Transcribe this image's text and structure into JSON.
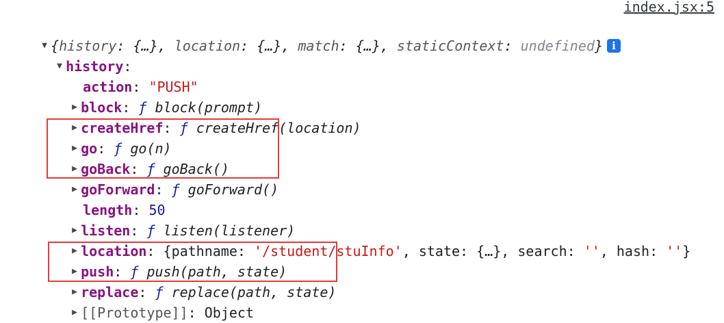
{
  "source_link": "index.jsx:5",
  "root": {
    "preview_open": "{",
    "preview_items": [
      {
        "key": "history",
        "value": "{…}"
      },
      {
        "key": "location",
        "value": "{…}"
      },
      {
        "key": "match",
        "value": "{…}"
      },
      {
        "key": "staticContext",
        "value": "undefined"
      }
    ],
    "preview_close": "}",
    "info_icon": "i"
  },
  "history": {
    "label": "history",
    "action": {
      "key": "action",
      "value": "\"PUSH\""
    },
    "block": {
      "key": "block",
      "f": "ƒ",
      "sig": "block(prompt)"
    },
    "createHref": {
      "key": "createHref",
      "f": "ƒ",
      "sig": "createHref(location)"
    },
    "go": {
      "key": "go",
      "f": "ƒ",
      "sig": "go(n)"
    },
    "goBack": {
      "key": "goBack",
      "f": "ƒ",
      "sig": "goBack()"
    },
    "goForward": {
      "key": "goForward",
      "f": "ƒ",
      "sig": "goForward()"
    },
    "length": {
      "key": "length",
      "value": "50"
    },
    "listen": {
      "key": "listen",
      "f": "ƒ",
      "sig": "listen(listener)"
    },
    "location": {
      "key": "location",
      "open": "{",
      "pathname_key": "pathname",
      "pathname_val": "'/student/stuInfo'",
      "state_key": "state",
      "state_val": "{…}",
      "search_key": "search",
      "search_val": "''",
      "hash_key": "hash",
      "hash_val": "''",
      "close": "}"
    },
    "push": {
      "key": "push",
      "f": "ƒ",
      "sig": "push(path, state)"
    },
    "replace": {
      "key": "replace",
      "f": "ƒ",
      "sig": "replace(path, state)"
    },
    "prototype": {
      "key": "[[Prototype]]",
      "value": "Object"
    }
  },
  "colors": {
    "highlight": "#e53935",
    "key": "#881280",
    "string": "#c41a16",
    "number": "#1a1aa6",
    "info_badge": "#1a73e8"
  }
}
